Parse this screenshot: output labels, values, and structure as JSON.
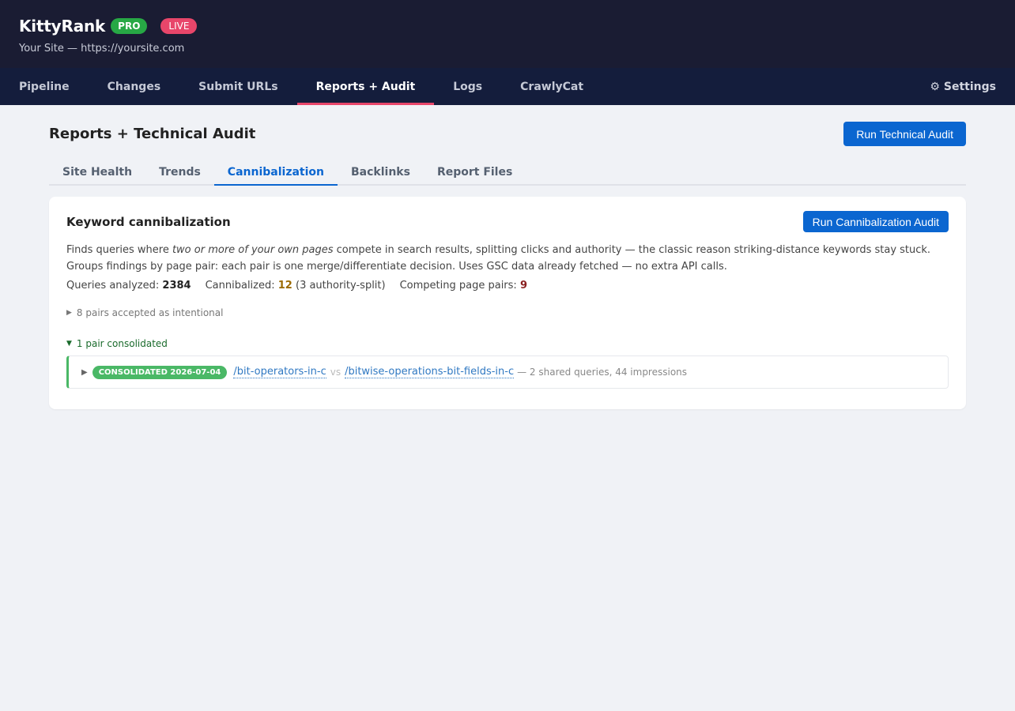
{
  "header": {
    "brand": "KittyRank",
    "pro_badge": "PRO",
    "live_badge": "LIVE",
    "site_line": "Your Site — https://yoursite.com"
  },
  "nav": {
    "items": [
      {
        "label": "Pipeline"
      },
      {
        "label": "Changes"
      },
      {
        "label": "Submit URLs"
      },
      {
        "label": "Reports + Audit",
        "active": true
      },
      {
        "label": "Logs"
      },
      {
        "label": "CrawlyCat"
      }
    ],
    "settings_label": "Settings",
    "settings_icon": "gear-icon"
  },
  "page": {
    "title": "Reports + Technical Audit",
    "run_audit_label": "Run Technical Audit"
  },
  "subtabs": [
    {
      "label": "Site Health"
    },
    {
      "label": "Trends"
    },
    {
      "label": "Cannibalization",
      "active": true
    },
    {
      "label": "Backlinks"
    },
    {
      "label": "Report Files"
    }
  ],
  "card": {
    "title": "Keyword cannibalization",
    "run_label": "Run Cannibalization Audit",
    "desc_pre": "Finds queries where ",
    "desc_em": "two or more of your own pages",
    "desc_post": " compete in search results, splitting clicks and authority — the classic reason striking-distance keywords stay stuck. Groups findings by page pair: each pair is one merge/differentiate decision. Uses GSC data already fetched — no extra API calls.",
    "stats": {
      "queries_label": "Queries analyzed: ",
      "queries_value": "2384",
      "cannibalized_label": "Cannibalized: ",
      "cannibalized_value": "12",
      "cannibalized_note": " (3 authority-split)",
      "pairs_label": "Competing page pairs: ",
      "pairs_value": "9"
    },
    "intentional_label": "8 pairs accepted as intentional",
    "consolidated_label": "1 pair consolidated",
    "pairs": [
      {
        "badge": "CONSOLIDATED 2026-07-04",
        "path_a": "/bit-operators-in-c",
        "vs": "vs",
        "path_b": "/bitwise-operations-bit-fields-in-c",
        "meta": "— 2 shared queries, 44 impressions"
      }
    ]
  },
  "colors": {
    "header_bg": "#1a1c33",
    "nav_bg": "#141d3c",
    "accent_pink": "#e8466a",
    "primary_blue": "#0b66d0",
    "success_green": "#4ab866"
  }
}
